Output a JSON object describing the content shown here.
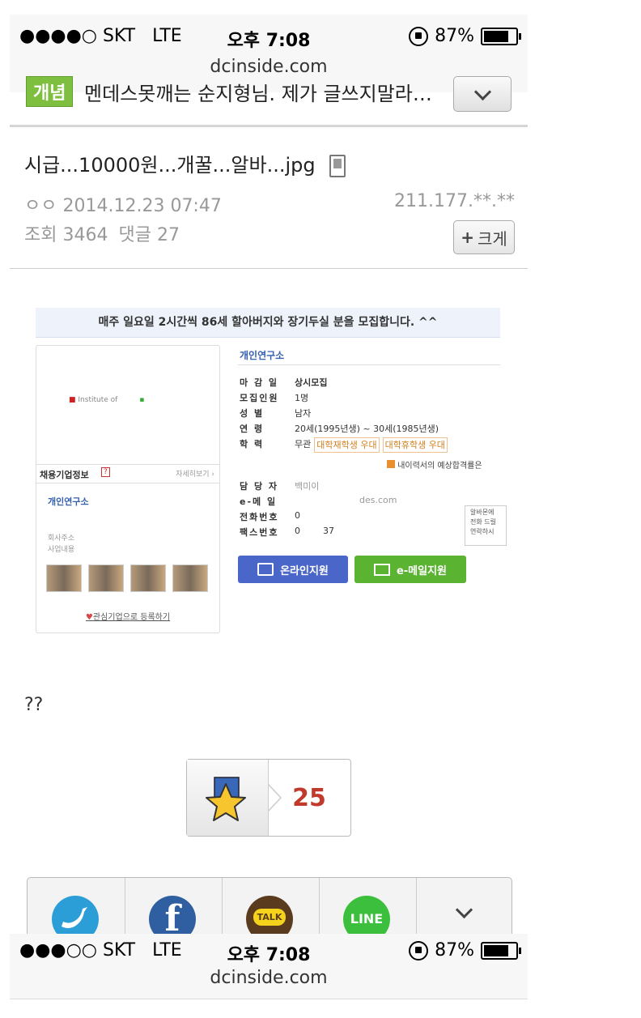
{
  "status_bar": {
    "carrier": "●●●●○ SKT",
    "network": "LTE",
    "time": "오후 7:08",
    "battery": "87%",
    "battery_level": 0.87,
    "url": "dcinside.com"
  },
  "topic_bar": {
    "badge": "개념",
    "title": "멘데스못깨는 순지형님. 제가 글쓰지말라…"
  },
  "post": {
    "title": "시급...10000원...개꿀...알바...jpg",
    "author": "ㅇㅇ",
    "date": "2014.12.23 07:47",
    "ip": "211.177.**.**",
    "views_label": "조회",
    "views": "3464",
    "comments_label": "댓글",
    "comments": "27",
    "size_button": "크게",
    "body_text": "??"
  },
  "embed": {
    "banner": "매주 일요일 2시간씩 86세 할아버지와 장기두실 분을 모집합니다. ^^",
    "company_section": "채용기업정보",
    "more_link": "자세히보기",
    "logo_text": "Institute of",
    "company_name": "개인연구소",
    "address_label": "회사주소",
    "business_label": "사업내용",
    "register_link": "관심기업으로 등록하기",
    "company_title": "개인연구소",
    "rows": [
      {
        "key": "마 감 일",
        "value": "상시모집"
      },
      {
        "key": "모집인원",
        "value": "1명"
      },
      {
        "key": "성    별",
        "value": "남자"
      },
      {
        "key": "연    령",
        "value": "20세(1995년생) ~ 30세(1985년생)"
      },
      {
        "key": "학    력",
        "value": "무관"
      }
    ],
    "tag1": "대학재학생 우대",
    "tag2": "대학휴학생 우대",
    "resume_note": "내이력서의 예상합격률은",
    "contact_rows": [
      {
        "key": "담 당 자",
        "value": "백미이"
      },
      {
        "key": "e-메 일",
        "value": "des.com"
      },
      {
        "key": "전화번호",
        "value": "0"
      },
      {
        "key": "팩스번호",
        "value": "0        37"
      }
    ],
    "side_note": [
      "알바몬에",
      "전화 드릴",
      "연락하시"
    ],
    "online_button": "온라인지원",
    "email_button": "e-메일지원"
  },
  "vote": {
    "count": "25"
  },
  "share": {
    "kakao_label": "TALK",
    "line_label": "LINE"
  },
  "status_bar2": {
    "carrier": "●●●○○ SKT",
    "network": "LTE",
    "time": "오후 7:08",
    "battery": "87%",
    "battery_level": 0.87,
    "url": "dcinside.com"
  },
  "colors": {
    "badge_green": "#7fbf3f",
    "vote_red": "#c0392b",
    "online_blue": "#4a66c8",
    "email_green": "#5bb332",
    "twitter": "#2b9ed8",
    "facebook": "#2f5fa0",
    "kakao": "#f5d31c",
    "line": "#3cbf3c"
  }
}
